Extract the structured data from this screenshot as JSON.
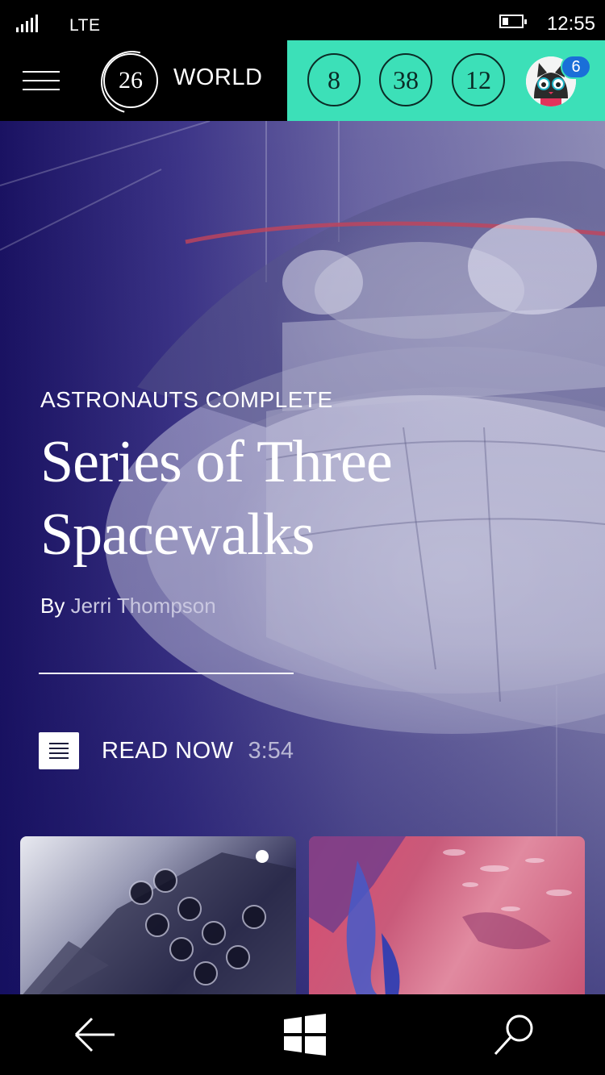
{
  "status_bar": {
    "network": "LTE",
    "time": "12:55"
  },
  "header": {
    "day_number": "26",
    "section": "WORLD",
    "stats": [
      "8",
      "38",
      "12"
    ],
    "notification_count": "6",
    "accent_color": "#3ce0b8"
  },
  "article": {
    "kicker": "ASTRONAUTS COMPLETE",
    "title_line1": "Series of Three",
    "title_line2": "Spacewalks",
    "by_label": "By",
    "author": "Jerri Thompson",
    "read_label": "READ NOW",
    "read_time": "3:54"
  },
  "icons": {
    "menu": "hamburger-icon",
    "read": "document-icon",
    "back": "back-arrow-icon",
    "home": "windows-icon",
    "search": "search-icon"
  }
}
